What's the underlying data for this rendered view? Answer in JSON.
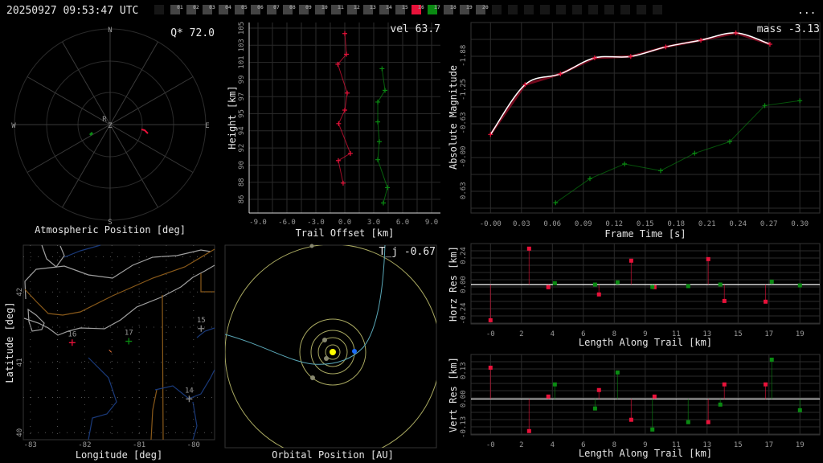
{
  "header": {
    "timestamp": "20250927 09:53:47 UTC",
    "more_label": "..."
  },
  "stations": {
    "labels": [
      "01",
      "02",
      "03",
      "04",
      "05",
      "06",
      "07",
      "08",
      "09",
      "10",
      "11",
      "12",
      "13",
      "14",
      "15",
      "16",
      "17",
      "18",
      "19",
      "20"
    ],
    "active_red": "16",
    "active_green": "17",
    "empty_before": 1,
    "empty_after": 11
  },
  "colors": {
    "red": "#e8123a",
    "green": "#0a8a12",
    "white": "#ffffff",
    "orbit": "#5aa8b8",
    "planet_orbit": "#a8a860",
    "sun": "#ffff00",
    "earth": "#1a6cff"
  },
  "polar": {
    "title": "Atmospheric Position [deg]",
    "metric": "Q* 72.0",
    "compass": {
      "n": "N",
      "s": "S",
      "e": "E",
      "w": "W",
      "z": "Z",
      "r": "R"
    }
  },
  "map": {
    "xlabel": "Longitude [deg]",
    "ylabel": "Latitude [deg]",
    "xticks": [
      -83,
      -82,
      -81,
      -80
    ],
    "yticks": [
      42,
      41,
      40
    ],
    "stations": [
      {
        "label": "16",
        "lon": -82.23,
        "lat": 41.28,
        "color": "#e8123a"
      },
      {
        "label": "17",
        "lon": -81.19,
        "lat": 41.3,
        "color": "#0a8a12"
      },
      {
        "label": "15",
        "lon": -79.86,
        "lat": 41.48,
        "color": "#888888"
      },
      {
        "label": "14",
        "lon": -80.08,
        "lat": 40.48,
        "color": "#888888"
      }
    ],
    "meteor": {
      "lon": -81.53,
      "lat": 41.16
    }
  },
  "orbit": {
    "title": "Orbital Position [AU]",
    "metric": "T_j -0.67"
  },
  "chart_data": [
    {
      "id": "height",
      "type": "scatter",
      "xlabel": "Trail Offset [km]",
      "ylabel": "Height [km]",
      "annotation": "vel 63.7",
      "xticks": [
        "-9.0",
        "-6.0",
        "-3.0",
        "0.0",
        "3.0",
        "6.0",
        "9.0"
      ],
      "xlim": [
        -9,
        9
      ],
      "yticks": [
        "105",
        "103",
        "101",
        "99",
        "97",
        "95",
        "94",
        "92",
        "90",
        "88",
        "86"
      ],
      "ylim": [
        86,
        105
      ],
      "series": [
        {
          "name": "16",
          "color": "#e8123a",
          "points": [
            [
              0,
              104.4
            ],
            [
              0.17,
              102.1
            ],
            [
              -0.72,
              101.0
            ],
            [
              0.25,
              97.8
            ],
            [
              0,
              95.9
            ],
            [
              -0.64,
              94.4
            ],
            [
              0.58,
              91.1
            ],
            [
              -0.67,
              90.3
            ],
            [
              -0.17,
              87.8
            ]
          ]
        },
        {
          "name": "17",
          "color": "#0a8a12",
          "points": [
            [
              3.86,
              100.5
            ],
            [
              4.17,
              98.1
            ],
            [
              3.42,
              96.8
            ],
            [
              3.42,
              94.6
            ],
            [
              3.58,
              92.4
            ],
            [
              3.42,
              90.4
            ],
            [
              4.42,
              87.3
            ],
            [
              4.0,
              85.6
            ]
          ]
        }
      ]
    },
    {
      "id": "magnitude",
      "type": "line",
      "xlabel": "Frame Time [s]",
      "ylabel": "Absolute Magnitude",
      "annotation": "mass -3.13",
      "xticks": [
        "-0.00",
        "0.03",
        "0.06",
        "0.09",
        "0.12",
        "0.15",
        "0.18",
        "0.21",
        "0.24",
        "0.27",
        "0.30"
      ],
      "xlim": [
        0,
        0.3
      ],
      "yticks": [
        "-1.88",
        "-1.25",
        "-0.63",
        "-0.00",
        "0.63"
      ],
      "ylim": [
        -1.88,
        0.63
      ],
      "series": [
        {
          "name": "16",
          "color": "#e8123a",
          "points": [
            [
              0,
              -0.415
            ],
            [
              0.0335,
              -1.342
            ],
            [
              0.0678,
              -1.541
            ],
            [
              0.101,
              -1.84
            ],
            [
              0.136,
              -1.865
            ],
            [
              0.17,
              -2.044
            ],
            [
              0.204,
              -2.169
            ],
            [
              0.238,
              -2.304
            ],
            [
              0.271,
              -2.094
            ]
          ]
        },
        {
          "name": "17",
          "color": "#0a8a12",
          "points": [
            [
              0.0631,
              0.855
            ],
            [
              0.0964,
              0.407
            ],
            [
              0.13,
              0.133
            ],
            [
              0.165,
              0.258
            ],
            [
              0.198,
              -0.066
            ],
            [
              0.232,
              -0.281
            ],
            [
              0.266,
              -0.953
            ],
            [
              0.3,
              -1.043
            ]
          ]
        }
      ]
    },
    {
      "id": "horz",
      "type": "scatter",
      "xlabel": "Length Along Trail [km]",
      "ylabel": "Horz Res [km]",
      "xticks": [
        "-0",
        "2",
        "4",
        "6",
        "8",
        "9",
        "11",
        "13",
        "15",
        "17",
        "19"
      ],
      "xlim": [
        0,
        19
      ],
      "yticks": [
        "0.24",
        "0.00",
        "-0.24"
      ],
      "yvals": [
        0.24,
        0,
        -0.24
      ],
      "series": [
        {
          "name": "16",
          "color": "#e8123a",
          "points": [
            [
              0,
              -0.296
            ],
            [
              2.37,
              0.298
            ],
            [
              3.55,
              -0.022
            ],
            [
              6.66,
              -0.082
            ],
            [
              8.64,
              0.198
            ],
            [
              10.07,
              -0.022
            ],
            [
              13.37,
              0.211
            ],
            [
              14.36,
              -0.136
            ],
            [
              16.89,
              -0.142
            ]
          ]
        },
        {
          "name": "17",
          "color": "#0a8a12",
          "points": [
            [
              3.95,
              0.011
            ],
            [
              6.42,
              0
            ],
            [
              7.8,
              0.018
            ],
            [
              9.94,
              -0.02
            ],
            [
              12.14,
              -0.013
            ],
            [
              14.11,
              0
            ],
            [
              17.27,
              0.024
            ],
            [
              19.0,
              -0.007
            ]
          ]
        }
      ]
    },
    {
      "id": "vert",
      "type": "scatter",
      "xlabel": "Length Along Trail [km]",
      "ylabel": "Vert Res [km]",
      "xticks": [
        "-0",
        "2",
        "4",
        "6",
        "8",
        "9",
        "11",
        "13",
        "15",
        "17",
        "19"
      ],
      "xlim": [
        0,
        19
      ],
      "yticks": [
        "0.13",
        "0.00",
        "-0.13"
      ],
      "yvals": [
        0.13,
        0,
        -0.13
      ],
      "series": [
        {
          "name": "16",
          "color": "#e8123a",
          "points": [
            [
              0,
              0.144
            ],
            [
              2.37,
              -0.148
            ],
            [
              3.55,
              0.011
            ],
            [
              6.66,
              0.041
            ],
            [
              8.64,
              -0.096
            ],
            [
              10.07,
              0.011
            ],
            [
              13.37,
              -0.107
            ],
            [
              14.36,
              0.067
            ],
            [
              16.89,
              0.067
            ]
          ]
        },
        {
          "name": "17",
          "color": "#0a8a12",
          "points": [
            [
              3.95,
              0.067
            ],
            [
              6.42,
              -0.044
            ],
            [
              7.8,
              0.122
            ],
            [
              9.94,
              -0.141
            ],
            [
              12.14,
              -0.107
            ],
            [
              14.11,
              -0.026
            ],
            [
              17.27,
              0.181
            ],
            [
              19.0,
              -0.052
            ]
          ]
        }
      ]
    }
  ]
}
